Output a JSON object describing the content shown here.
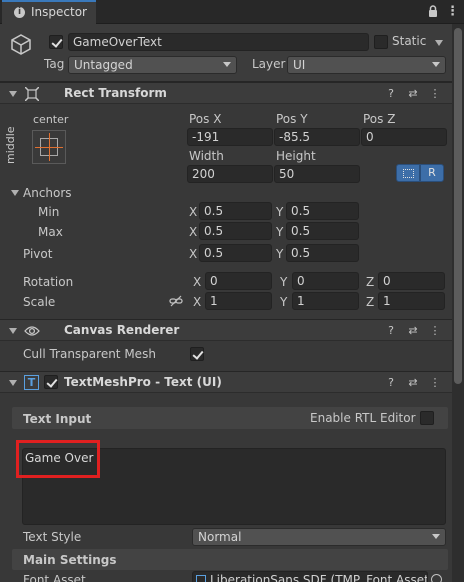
{
  "tab": {
    "title": "Inspector"
  },
  "object": {
    "name": "GameOverText",
    "static_label": "Static",
    "tag_label": "Tag",
    "tag_value": "Untagged",
    "layer_label": "Layer",
    "layer_value": "UI"
  },
  "rect_transform": {
    "title": "Rect Transform",
    "anchor_h": "center",
    "anchor_v": "middle",
    "pos_x_label": "Pos X",
    "pos_y_label": "Pos Y",
    "pos_z_label": "Pos Z",
    "pos_x": "-191",
    "pos_y": "-85.5",
    "pos_z": "0",
    "width_label": "Width",
    "height_label": "Height",
    "width": "200",
    "height": "50",
    "raw_button": "R",
    "anchors_label": "Anchors",
    "min_label": "Min",
    "max_label": "Max",
    "min_x": "0.5",
    "min_y": "0.5",
    "max_x": "0.5",
    "max_y": "0.5",
    "pivot_label": "Pivot",
    "pivot_x": "0.5",
    "pivot_y": "0.5",
    "rotation_label": "Rotation",
    "rot_x": "0",
    "rot_y": "0",
    "rot_z": "0",
    "scale_label": "Scale",
    "scale_x": "1",
    "scale_y": "1",
    "scale_z": "1",
    "x": "X",
    "y": "Y",
    "z": "Z"
  },
  "canvas_renderer": {
    "title": "Canvas Renderer",
    "cull_label": "Cull Transparent Mesh"
  },
  "tmp": {
    "title": "TextMeshPro - Text (UI)",
    "text_input_label": "Text Input",
    "rtl_label": "Enable RTL Editor",
    "text_value": "Game Over",
    "text_style_label": "Text Style",
    "text_style_value": "Normal",
    "main_settings_label": "Main Settings",
    "font_asset_label": "Font Asset",
    "font_asset_value": "LiberationSans SDF (TMP_Font Asset)"
  },
  "colors": {
    "highlight": "#e02020",
    "accent": "#3d6ea8"
  }
}
